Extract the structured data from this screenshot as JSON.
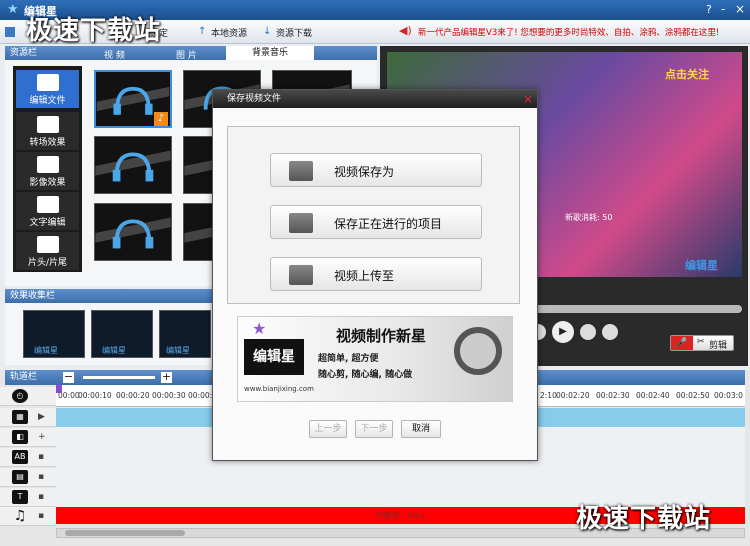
{
  "window": {
    "title": "编辑星",
    "help": "?",
    "minimize": "-",
    "close": "×"
  },
  "toolbar": {
    "items": [
      "设定",
      "本地资源",
      "资源下载"
    ],
    "promo": "新一代产品编辑星V3来了! 您想要的更多时尚特效、自拍、涂鸦、涂鸦都在这里!"
  },
  "resource_panel": {
    "title": "资源栏",
    "tabs": [
      "视 频",
      "图 片",
      "背景音乐"
    ]
  },
  "left_nav": {
    "items": [
      "编辑文件",
      "转场效果",
      "影像效果",
      "文字编辑",
      "片头/片尾"
    ]
  },
  "effects_panel": {
    "title": "效果收集栏"
  },
  "thumb_logo": "编辑星",
  "dialog": {
    "title": "保存视频文件",
    "buttons": [
      "视频保存为",
      "保存正在进行的项目",
      "视频上传至"
    ],
    "banner": {
      "headline": "视频制作新星",
      "line1": "超简单, 超方便",
      "line2": "随心剪, 随心编, 随心做",
      "logo": "编辑星",
      "url": "www.bianjixing.com"
    },
    "prev": "上一步",
    "next": "下一步",
    "cancel": "取消"
  },
  "preview": {
    "cut_button": "剪辑",
    "follow": "点击关注",
    "score": "新歌消耗: 50",
    "logo": "编辑星"
  },
  "timeline": {
    "title": "轨道栏",
    "ticks": [
      "00:00",
      "00:00:10",
      "00:00:20",
      "00:00:30",
      "00:00:4",
      "2:10",
      "00:02:20",
      "00:02:30",
      "00:02:40",
      "00:02:50",
      "00:03:0"
    ],
    "audio_clip": "功能根 - Ainy",
    "track_icons": [
      "clock",
      "video",
      "audio-fx",
      "text-ab",
      "transition",
      "text-t",
      "music"
    ]
  },
  "watermark": "极速下载站",
  "colors": {
    "accent": "#2f6fd0",
    "audio_track": "#ff0000",
    "video_track": "#87cce8"
  }
}
